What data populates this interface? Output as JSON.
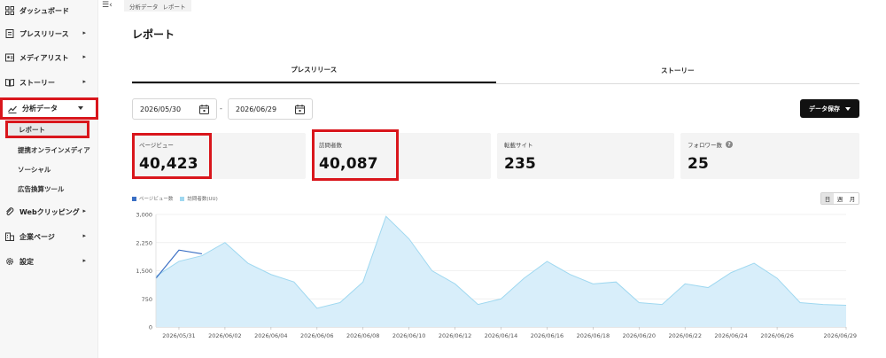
{
  "sidebar": {
    "items": [
      {
        "label": "ダッシュボード",
        "icon": "dashboard-icon",
        "chevron": false
      },
      {
        "label": "プレスリリース",
        "icon": "document-icon",
        "chevron": true
      },
      {
        "label": "メディアリスト",
        "icon": "contacts-icon",
        "chevron": true
      },
      {
        "label": "ストーリー",
        "icon": "book-icon",
        "chevron": true
      },
      {
        "label": "分析データ",
        "icon": "analytics-icon",
        "chevron": true
      },
      {
        "label": "Webクリッピング",
        "icon": "clip-icon",
        "chevron": true
      },
      {
        "label": "企業ページ",
        "icon": "company-icon",
        "chevron": true
      },
      {
        "label": "設定",
        "icon": "gear-icon",
        "chevron": true
      }
    ],
    "sub_items": [
      "レポート",
      "提携オンラインメディア",
      "ソーシャル",
      "広告換算ツール"
    ]
  },
  "breadcrumb": [
    "分析データ",
    "レポート"
  ],
  "page_title": "レポート",
  "tabs": [
    "プレスリリース",
    "ストーリー"
  ],
  "date_range": {
    "start": "2026/05/30",
    "end": "2026/06/29",
    "separator": "-"
  },
  "save_button": "データ保存",
  "stats": [
    {
      "label": "ページビュー",
      "value": "40,423"
    },
    {
      "label": "訪問者数",
      "value": "40,087"
    },
    {
      "label": "転載サイト",
      "value": "235"
    },
    {
      "label": "フォロワー数",
      "value": "25"
    }
  ],
  "help_glyph": "?",
  "period_toggle": [
    "日",
    "週",
    "月"
  ],
  "colors": {
    "pageviews": "#3a6fc4",
    "visitors": "#9fd8f0",
    "visitors_fill": "#d8eefa",
    "highlight": "#d9161c"
  },
  "chart_data": {
    "type": "area",
    "x": [
      "2026/05/30",
      "2026/05/31",
      "2026/06/01",
      "2026/06/02",
      "2026/06/03",
      "2026/06/04",
      "2026/06/05",
      "2026/06/06",
      "2026/06/07",
      "2026/06/08",
      "2026/06/09",
      "2026/06/10",
      "2026/06/11",
      "2026/06/12",
      "2026/06/13",
      "2026/06/14",
      "2026/06/15",
      "2026/06/16",
      "2026/06/17",
      "2026/06/18",
      "2026/06/19",
      "2026/06/20",
      "2026/06/21",
      "2026/06/22",
      "2026/06/23",
      "2026/06/24",
      "2026/06/25",
      "2026/06/26",
      "2026/06/27",
      "2026/06/28",
      "2026/06/29"
    ],
    "xticks": [
      "2026/05/31",
      "2026/06/02",
      "2026/06/04",
      "2026/06/06",
      "2026/06/08",
      "2026/06/10",
      "2026/06/12",
      "2026/06/14",
      "2026/06/16",
      "2026/06/18",
      "2026/06/20",
      "2026/06/22",
      "2026/06/24",
      "2026/06/26",
      "2026/06/29"
    ],
    "yticks": [
      "0",
      "750",
      "1,500",
      "2,250",
      "3,000"
    ],
    "ylim": [
      0,
      3000
    ],
    "grid": true,
    "legend": "top-left",
    "series": [
      {
        "name": "ページビュー数",
        "values": [
          1300,
          2050,
          1950,
          null,
          null,
          null,
          null,
          null,
          null,
          null,
          null,
          null,
          null,
          null,
          null,
          null,
          null,
          null,
          null,
          null,
          null,
          null,
          null,
          null,
          null,
          null,
          null,
          null,
          null,
          null,
          null
        ]
      },
      {
        "name": "訪問者数(UU)",
        "values": [
          1350,
          1750,
          1900,
          2250,
          1700,
          1400,
          1200,
          500,
          650,
          1200,
          2950,
          2350,
          1500,
          1150,
          600,
          750,
          1300,
          1750,
          1400,
          1150,
          1200,
          650,
          600,
          1150,
          1050,
          1450,
          1700,
          1300,
          650,
          600,
          580
        ]
      }
    ]
  }
}
